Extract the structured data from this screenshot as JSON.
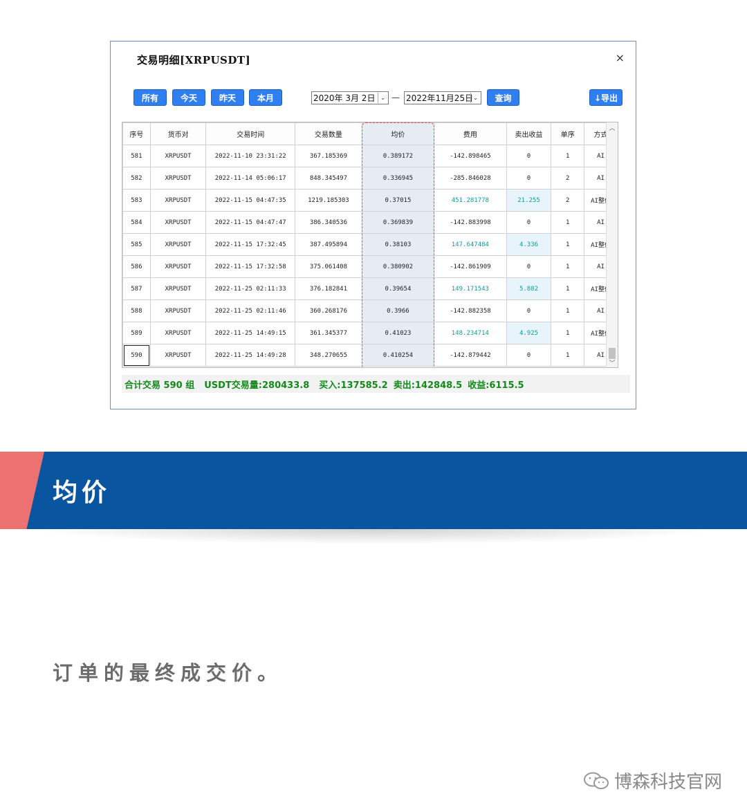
{
  "window": {
    "title": "交易明细[XRPUSDT]",
    "close_label": "×"
  },
  "toolbar": {
    "btn_all": "所有",
    "btn_today": "今天",
    "btn_yesterday": "昨天",
    "btn_month": "本月",
    "date_from": "2020年 3月 2日",
    "date_to": "2022年11月25日",
    "date_sep": "—",
    "btn_query": "查询",
    "btn_export": "↓导出",
    "dropdown_glyph": "⌄"
  },
  "table": {
    "headers": [
      "序号",
      "货币对",
      "交易时间",
      "交易数量",
      "均价",
      "费用",
      "卖出收益",
      "单序",
      "方式"
    ],
    "rows": [
      [
        "581",
        "XRPUSDT",
        "2022-11-10 23:31:22",
        "367.185369",
        "0.389172",
        "-142.898465",
        "0",
        "1",
        "AI"
      ],
      [
        "582",
        "XRPUSDT",
        "2022-11-14 05:06:17",
        "848.345497",
        "0.336945",
        "-285.846028",
        "0",
        "2",
        "AI"
      ],
      [
        "583",
        "XRPUSDT",
        "2022-11-15 04:47:35",
        "1219.185303",
        "0.37015",
        "451.281778",
        "21.255",
        "2",
        "AI整体"
      ],
      [
        "584",
        "XRPUSDT",
        "2022-11-15 04:47:47",
        "386.340536",
        "0.369839",
        "-142.883998",
        "0",
        "1",
        "AI"
      ],
      [
        "585",
        "XRPUSDT",
        "2022-11-15 17:32:45",
        "387.495894",
        "0.38103",
        "147.647484",
        "4.336",
        "1",
        "AI整体"
      ],
      [
        "586",
        "XRPUSDT",
        "2022-11-15 17:32:58",
        "375.061408",
        "0.380902",
        "-142.861909",
        "0",
        "1",
        "AI"
      ],
      [
        "587",
        "XRPUSDT",
        "2022-11-25 02:11:33",
        "376.182841",
        "0.39654",
        "149.171543",
        "5.882",
        "1",
        "AI整体"
      ],
      [
        "588",
        "XRPUSDT",
        "2022-11-25 02:11:46",
        "360.268176",
        "0.3966",
        "-142.882358",
        "0",
        "1",
        "AI"
      ],
      [
        "589",
        "XRPUSDT",
        "2022-11-25 14:49:15",
        "361.345377",
        "0.41023",
        "148.234714",
        "4.925",
        "1",
        "AI整体"
      ],
      [
        "590",
        "XRPUSDT",
        "2022-11-25 14:49:28",
        "348.270655",
        "0.410254",
        "-142.879442",
        "0",
        "1",
        "AI"
      ]
    ],
    "positive_color": "#0a9ba0"
  },
  "summary": {
    "count": "合计交易 590 组",
    "volume": "USDT交易量:280433.8",
    "buy": "买入:137585.2",
    "sell": "卖出:142848.5",
    "profit": "收益:6115.5"
  },
  "banner": {
    "title": "均价",
    "bg_color": "#0a55a0",
    "accent_color": "#ec7272"
  },
  "description": "订单的最终成交价。",
  "watermark": "博森科技官网"
}
